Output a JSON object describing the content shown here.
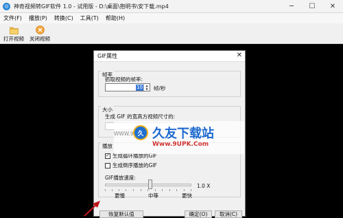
{
  "window": {
    "title": "神奇视频转GIF软件 1.0 - 试用版 - D:\\桌面\\抱明书\\安下载.mp4",
    "app_icon": "app-logo-icon"
  },
  "menu": [
    "文件(F)",
    "播放(P)",
    "转换(C)",
    "工具(T)",
    "帮助(H)"
  ],
  "toolbar": {
    "open_label": "打开视频",
    "close_label": "关闭视频",
    "open_icon": "folder-icon",
    "close_icon": "close-video-icon"
  },
  "dialog": {
    "title": "GIF属性",
    "frame_rate": {
      "group_label": "帧率",
      "field_label": "抓取视频的帧率:",
      "value": "10",
      "unit": "帧/秒"
    },
    "size": {
      "group_label": "大小",
      "field_label": "生成 GIF 的宽高方视频尺寸的:"
    },
    "playback": {
      "group_label": "播放",
      "loop_label": "生成循环播放的GIF",
      "loop_checked": true,
      "reverse_label": "生成倒序播放的GIF",
      "reverse_checked": false,
      "speed_label": "GIF播放速度:",
      "speed_value": "1.0 X",
      "speed_level": 0.5,
      "tick_slow": "更慢",
      "tick_mid": "中等",
      "tick_fast": "更快"
    },
    "buttons": {
      "restore": "恢复默认值",
      "ok": "确定(O)",
      "cancel": "取消(C)"
    }
  },
  "watermark": {
    "title": "久友下载站",
    "url": "Www.9UPK.Com",
    "left_text": "WWW.9U"
  }
}
